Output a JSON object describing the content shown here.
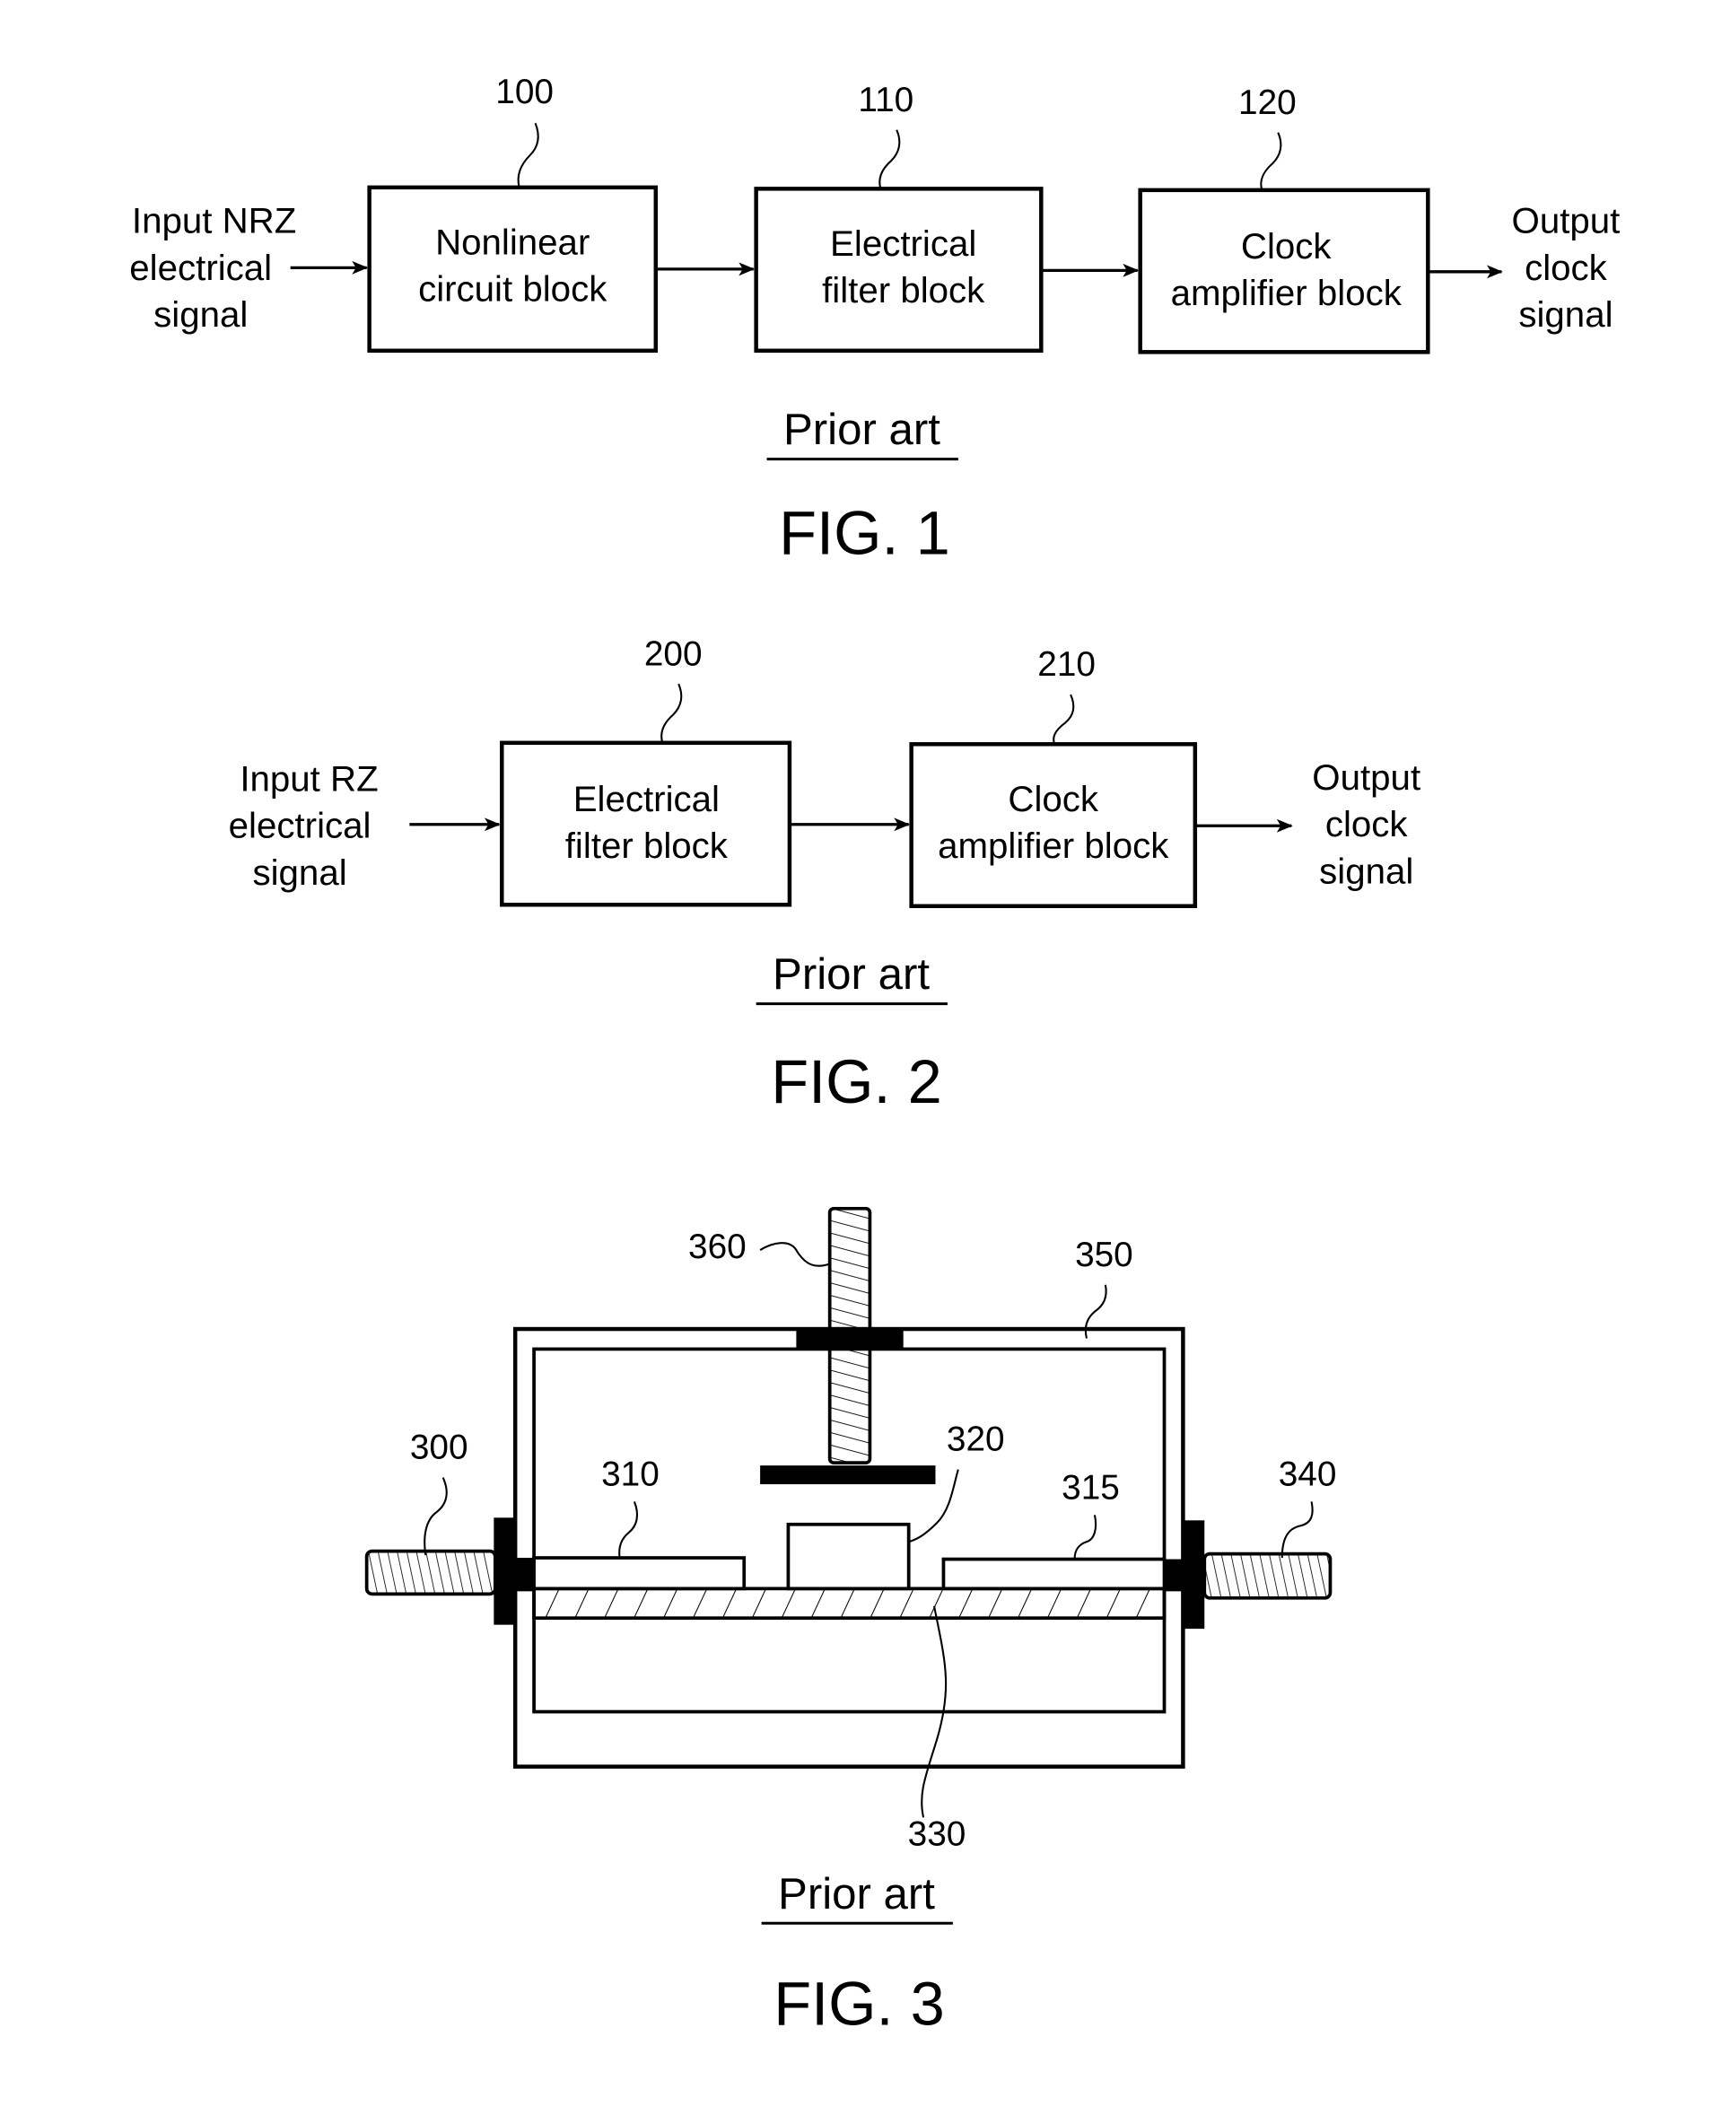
{
  "figures": [
    {
      "id": "fig1",
      "caption": "FIG. 1",
      "prior_art_label": "Prior art",
      "input_label": [
        "Input NRZ",
        "electrical",
        "signal"
      ],
      "output_label": [
        "Output",
        "clock",
        "signal"
      ],
      "blocks": [
        {
          "ref": "100",
          "lines": [
            "Nonlinear",
            "circuit block"
          ]
        },
        {
          "ref": "110",
          "lines": [
            "Electrical",
            "filter block"
          ]
        },
        {
          "ref": "120",
          "lines": [
            "Clock",
            "amplifier block"
          ]
        }
      ]
    },
    {
      "id": "fig2",
      "caption": "FIG. 2",
      "prior_art_label": "Prior art",
      "input_label": [
        "Input RZ",
        "electrical",
        "signal"
      ],
      "output_label": [
        "Output",
        "clock",
        "signal"
      ],
      "blocks": [
        {
          "ref": "200",
          "lines": [
            "Electrical",
            "filter block"
          ]
        },
        {
          "ref": "210",
          "lines": [
            "Clock",
            "amplifier block"
          ]
        }
      ]
    },
    {
      "id": "fig3",
      "caption": "FIG. 3",
      "prior_art_label": "Prior art",
      "refs": {
        "connector_left": "300",
        "line_left": "310",
        "line_right": "315",
        "device": "320",
        "substrate": "330",
        "connector_right": "340",
        "housing": "350",
        "tuning_screw": "360"
      }
    }
  ]
}
